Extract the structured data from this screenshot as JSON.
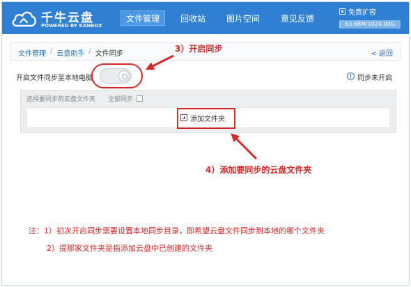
{
  "app": {
    "name": "千牛云盘",
    "tagline": "POWERED BY KANBOX"
  },
  "nav": {
    "items": [
      {
        "label": "文件管理",
        "active": true
      },
      {
        "label": "回收站",
        "active": false
      },
      {
        "label": "图片空间",
        "active": false
      },
      {
        "label": "意见反馈",
        "active": false
      }
    ]
  },
  "quota": {
    "label": "免费扩容",
    "usage_text": "63.68M/1024.00G",
    "used_fraction": 0.0001
  },
  "breadcrumb": {
    "items": [
      "文件管理",
      "云盘助手",
      "文件同步"
    ],
    "separator": "/",
    "back_label": "< 返回"
  },
  "sync": {
    "toggle_label": "开启文件同步至本地电脑",
    "toggle_on": false,
    "status_icon": "info-icon",
    "status_text": "同步未开启"
  },
  "folder_panel": {
    "header_label": "选择要同步的云盘文件夹",
    "select_all_label": "全部同步",
    "select_all_checked": false,
    "add_folder_label": "添加文件夹"
  },
  "annotations": {
    "step3": "3）开启同步",
    "step4": "4）添加要同步的云盘文件夹",
    "note_line1": "注：1）初次开启同步需要设置本地同步目录，即希望云盘文件同步到本地的哪个文件夹",
    "note_line2": "2）提那家文件夹是指添加云盘中已创建的文件夹",
    "color": "#d22828"
  },
  "colors": {
    "header": "#2f7fd3",
    "link": "#2f6fb7",
    "panel": "#eceef0"
  }
}
